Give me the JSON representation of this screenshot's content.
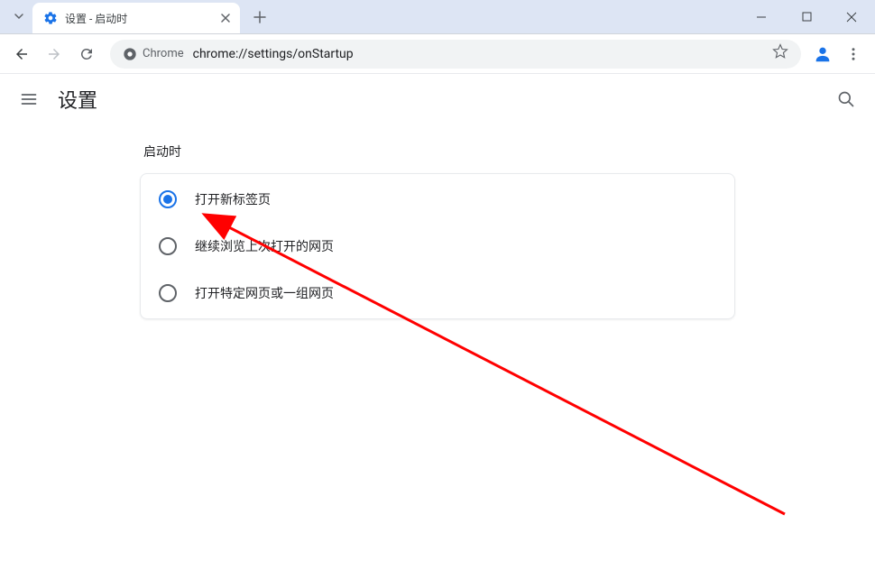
{
  "browser": {
    "tab_title": "设置 - 启动时",
    "security_label": "Chrome",
    "url": "chrome://settings/onStartup"
  },
  "settings_header": {
    "title": "设置"
  },
  "section": {
    "title": "启动时",
    "options": [
      {
        "label": "打开新标签页",
        "selected": true
      },
      {
        "label": "继续浏览上次打开的网页",
        "selected": false
      },
      {
        "label": "打开特定网页或一组网页",
        "selected": false
      }
    ]
  }
}
